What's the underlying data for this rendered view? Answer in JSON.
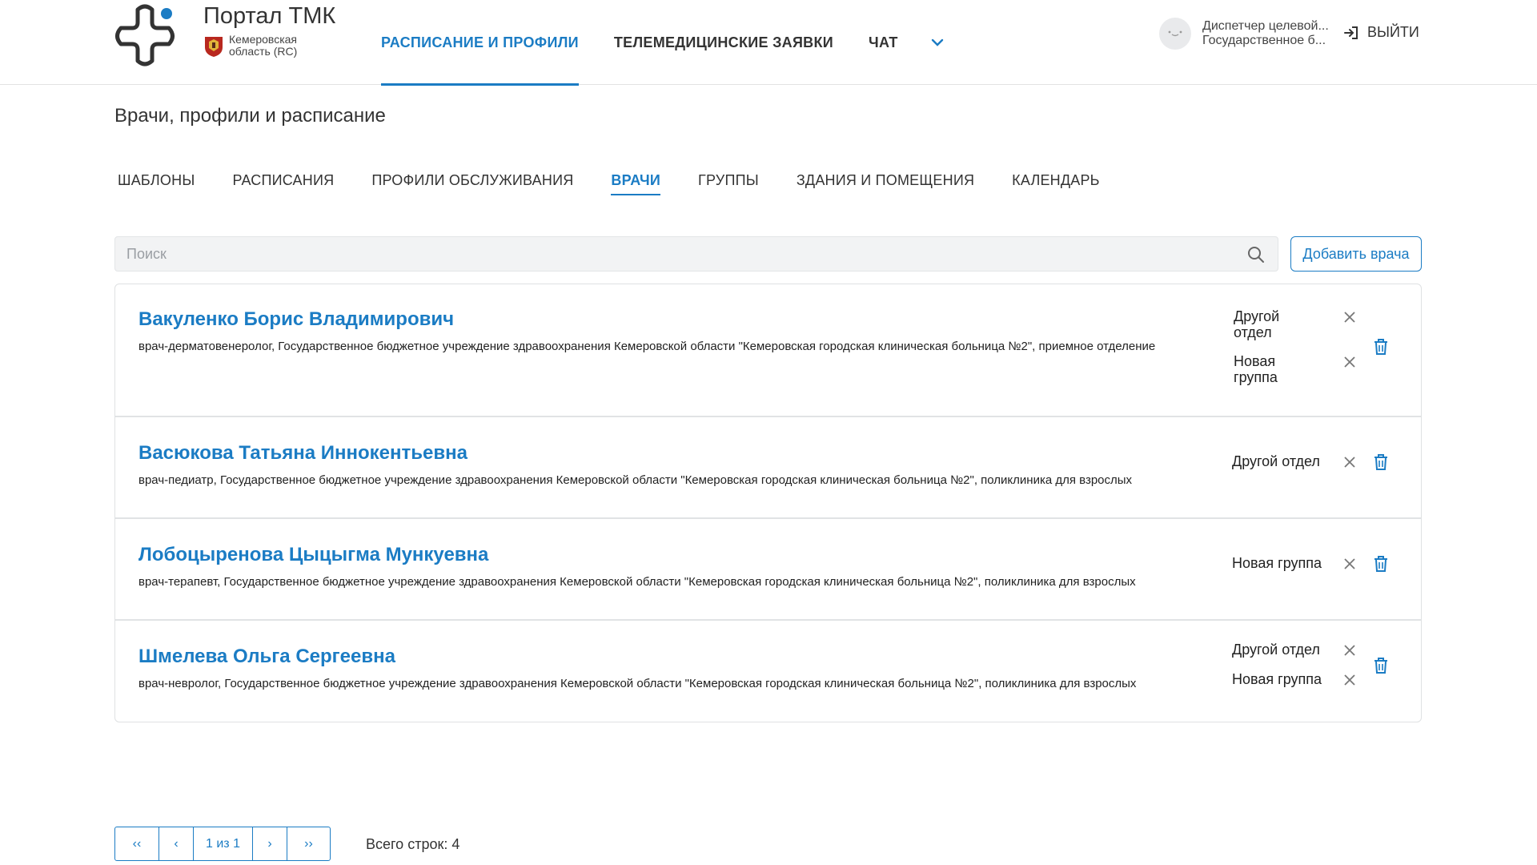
{
  "header": {
    "portal_title": "Портал ТМК",
    "region": "Кемеровская область (RC)",
    "nav": [
      {
        "label": "РАСПИСАНИЕ И ПРОФИЛИ",
        "active": true
      },
      {
        "label": "ТЕЛЕМЕДИЦИНСКИЕ ЗАЯВКИ",
        "active": false
      },
      {
        "label": "ЧАТ",
        "active": false
      }
    ],
    "user_line1": "Диспетчер целевой...",
    "user_line2": "Государственное б...",
    "logout_label": "ВЫЙТИ"
  },
  "page": {
    "title": "Врачи, профили и расписание",
    "tabs": [
      {
        "label": "ШАБЛОНЫ"
      },
      {
        "label": "РАСПИСАНИЯ"
      },
      {
        "label": "ПРОФИЛИ ОБСЛУЖИВАНИЯ"
      },
      {
        "label": "ВРАЧИ",
        "active": true
      },
      {
        "label": "ГРУППЫ"
      },
      {
        "label": "ЗДАНИЯ И ПОМЕЩЕНИЯ"
      },
      {
        "label": "КАЛЕНДАРЬ"
      }
    ],
    "search_placeholder": "Поиск",
    "add_button": "Добавить врача"
  },
  "doctors": [
    {
      "name": "Вакуленко Борис Владимирович",
      "description": "врач-дерматовенеролог, Государственное бюджетное учреждение здравоохранения Кемеровской области \"Кемеровская городская клиническая больница №2\", приемное отделение",
      "tags": [
        "Другой отдел",
        "Новая группа"
      ]
    },
    {
      "name": "Васюкова Татьяна Иннокентьевна",
      "description": "врач-педиатр, Государственное бюджетное учреждение здравоохранения Кемеровской области \"Кемеровская городская клиническая больница №2\", поликлиника для взрослых",
      "tags": [
        "Другой отдел"
      ]
    },
    {
      "name": "Лобоцыренова Цыцыгма Мункуевна",
      "description": "врач-терапевт, Государственное бюджетное учреждение здравоохранения Кемеровской области \"Кемеровская городская клиническая больница №2\", поликлиника для взрослых",
      "tags": [
        "Новая группа"
      ]
    },
    {
      "name": "Шмелева Ольга Сергеевна",
      "description": "врач-невролог, Государственное бюджетное учреждение здравоохранения Кемеровской области \"Кемеровская городская клиническая больница №2\", поликлиника для взрослых",
      "tags": [
        "Другой отдел",
        "Новая группа"
      ]
    }
  ],
  "pagination": {
    "first": "‹‹",
    "prev": "‹",
    "current": "1 из 1",
    "next": "›",
    "last": "››",
    "total": "Всего строк: 4"
  },
  "colors": {
    "accent": "#1b7cc4",
    "danger_icon": "#1b7cc4"
  }
}
